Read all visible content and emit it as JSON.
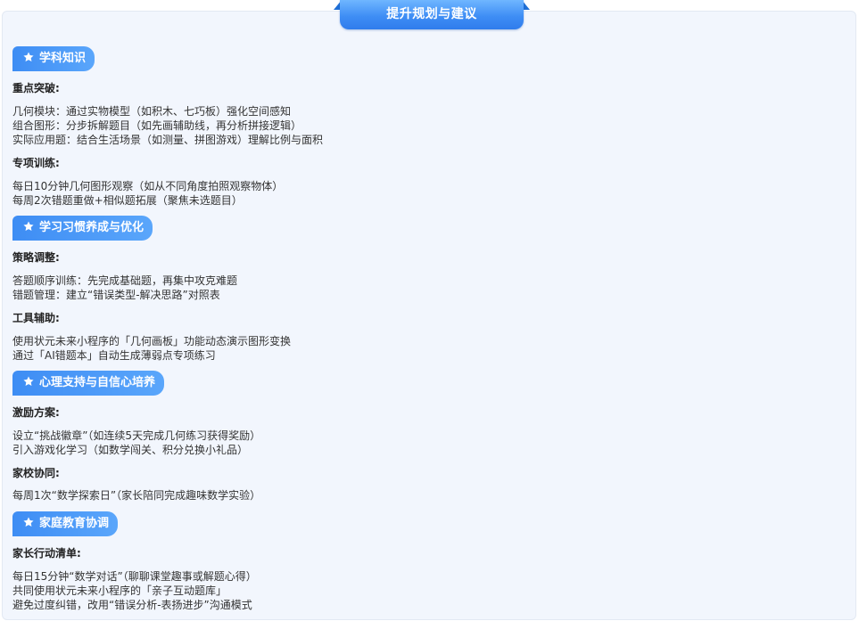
{
  "header": {
    "title": "提升规划与建议"
  },
  "sections": [
    {
      "title": "学科知识",
      "groups": [
        {
          "heading": "重点突破:",
          "lines": [
            "几何模块：通过实物模型（如积木、七巧板）强化空间感知",
            "组合图形：分步拆解题目（如先画辅助线，再分析拼接逻辑）",
            "实际应用题：结合生活场景（如测量、拼图游戏）理解比例与面积"
          ]
        },
        {
          "heading": "专项训练:",
          "lines": [
            "每日10分钟几何图形观察（如从不同角度拍照观察物体）",
            "每周2次错题重做+相似题拓展（聚焦未选题目）"
          ]
        }
      ]
    },
    {
      "title": "学习习惯养成与优化",
      "groups": [
        {
          "heading": "策略调整:",
          "lines": [
            "答题顺序训练：先完成基础题，再集中攻克难题",
            "错题管理：建立“错误类型-解决思路”对照表"
          ]
        },
        {
          "heading": "工具辅助:",
          "lines": [
            "使用状元未来小程序的「几何画板」功能动态演示图形变换",
            "通过「AI错题本」自动生成薄弱点专项练习"
          ]
        }
      ]
    },
    {
      "title": "心理支持与自信心培养",
      "groups": [
        {
          "heading": "激励方案:",
          "lines": [
            "设立“挑战徽章”（如连续5天完成几何练习获得奖励）",
            "引入游戏化学习（如数学闯关、积分兑换小礼品）"
          ]
        },
        {
          "heading": "家校协同:",
          "lines": [
            "每周1次“数学探索日”（家长陪同完成趣味数学实验）"
          ]
        }
      ]
    },
    {
      "title": "家庭教育协调",
      "groups": [
        {
          "heading": "家长行动清单:",
          "lines": [
            "每日15分钟“数学对话”（聊聊课堂趣事或解题心得）",
            "共同使用状元未来小程序的「亲子互动题库」",
            "避免过度纠错，改用“错误分析-表扬进步”沟通模式"
          ]
        }
      ]
    }
  ]
}
